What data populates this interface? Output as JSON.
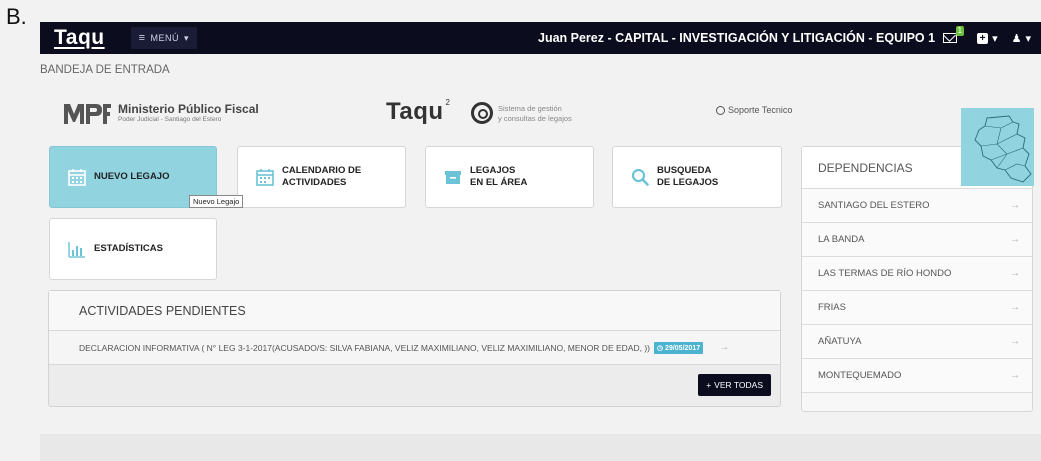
{
  "figure_label": "B.",
  "topbar": {
    "brand": "Taqu",
    "menu_label": "MENÚ",
    "user_info": "Juan Perez - CAPITAL - INVESTIGACIÓN Y LITIGACIÓN - EQUIPO 1",
    "mail_badge": "1"
  },
  "breadcrumb": "BANDEJA DE ENTRADA",
  "logos": {
    "mpf_title": "Ministerio Público Fiscal",
    "mpf_subtitle": "Poder Judicial - Santiago del Estero",
    "taqu": "Taqu",
    "taqu_sup": "2",
    "system_line1": "Sistema de gestión",
    "system_line2": "y consultas de legajos",
    "soporte": "Soporte Tecnico"
  },
  "tiles": {
    "nuevo": "NUEVO LEGAJO",
    "calendario": "CALENDARIO DE\nACTIVIDADES",
    "legajos": "LEGAJOS\nEN EL ÁREA",
    "busqueda": "BUSQUEDA\nDE LEGAJOS",
    "estadisticas": "ESTADÍSTICAS"
  },
  "tooltip": "Nuevo Legajo",
  "pendientes": {
    "title": "ACTIVIDADES PENDIENTES",
    "activity_text": "DECLARACION INFORMATIVA ( N° LEG 3-1-2017(ACUSADO/S: SILVA FABIANA, VELIZ MAXIMILIANO, VELIZ MAXIMILIANO, MENOR DE EDAD, ))",
    "activity_date": "29/05/2017",
    "ver_todas": "VER TODAS"
  },
  "dependencias": {
    "title": "DEPENDENCIAS",
    "items": [
      "SANTIAGO DEL ESTERO",
      "LA BANDA",
      "LAS TERMAS DE RÍO HONDO",
      "FRIAS",
      "AÑATUYA",
      "MONTEQUEMADO"
    ]
  },
  "colors": {
    "topbar": "#0b0c1e",
    "accent": "#92d3e0",
    "date_badge": "#4bb3d0",
    "mail_badge": "#6cbf3a"
  }
}
